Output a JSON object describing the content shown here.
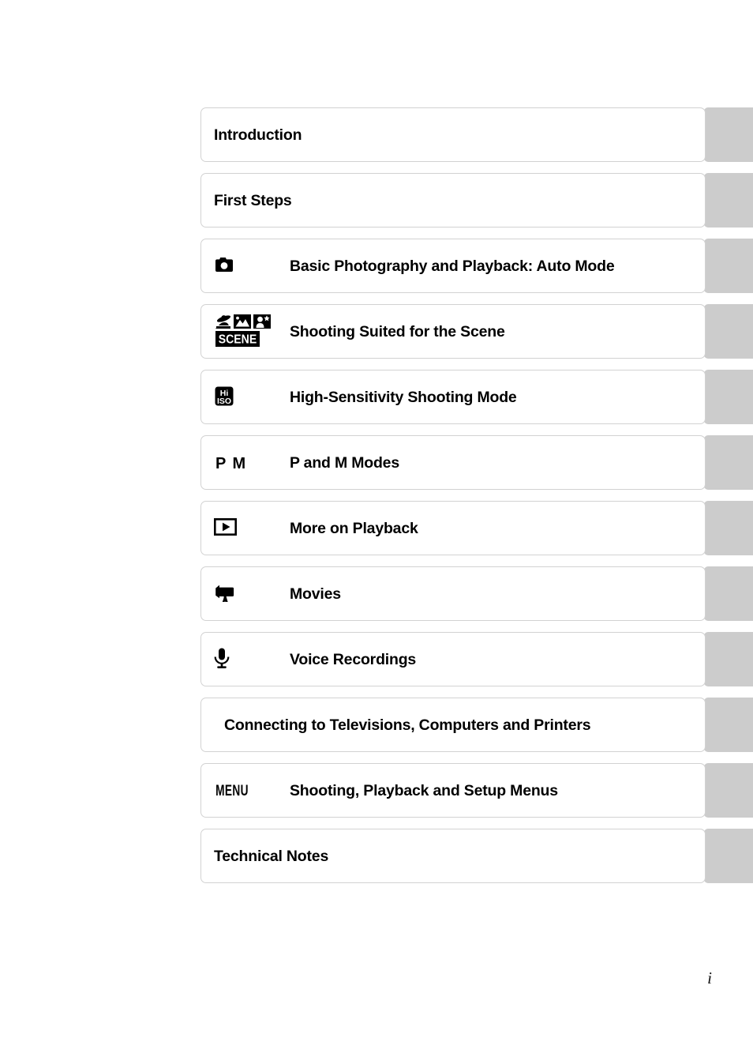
{
  "page": {
    "number": "i"
  },
  "chapters": [
    {
      "icon": "none",
      "title": "Introduction",
      "title_style": "no-icon"
    },
    {
      "icon": "none",
      "title": "First Steps",
      "title_style": "no-icon"
    },
    {
      "icon": "camera-icon",
      "title": "Basic Photography and Playback: Auto Mode",
      "title_style": "with-icon"
    },
    {
      "icon": "scene-mode-icon",
      "title": "Shooting Suited for the Scene",
      "title_style": "with-icon"
    },
    {
      "icon": "high-iso-icon",
      "title": "High-Sensitivity Shooting Mode",
      "title_style": "with-icon"
    },
    {
      "icon": "p-m-mode-icon",
      "icon_text": "P M",
      "title": "P and M Modes",
      "title_style": "with-icon"
    },
    {
      "icon": "playback-icon",
      "title": "More on Playback",
      "title_style": "with-icon"
    },
    {
      "icon": "movie-camera-icon",
      "title": "Movies",
      "title_style": "with-icon"
    },
    {
      "icon": "microphone-icon",
      "title": "Voice Recordings",
      "title_style": "with-icon"
    },
    {
      "icon": "none",
      "title": "Connecting to Televisions, Computers and Printers",
      "title_style": "indented"
    },
    {
      "icon": "menu-icon",
      "icon_text": "MENU",
      "title": "Shooting, Playback and Setup Menus",
      "title_style": "with-icon"
    },
    {
      "icon": "none",
      "title": "Technical Notes",
      "title_style": "no-icon"
    }
  ],
  "colors": {
    "tab": "#cccccc",
    "box_border": "#d2d2d2",
    "text": "#000000",
    "page_background": "#ffffff"
  },
  "scene_icon": {
    "label": "SCENE",
    "tiles": [
      "beach-party-scene",
      "landscape-scene",
      "night-portrait-scene"
    ]
  },
  "high_iso_icon": {
    "line1": "Hi",
    "line2": "ISO"
  }
}
